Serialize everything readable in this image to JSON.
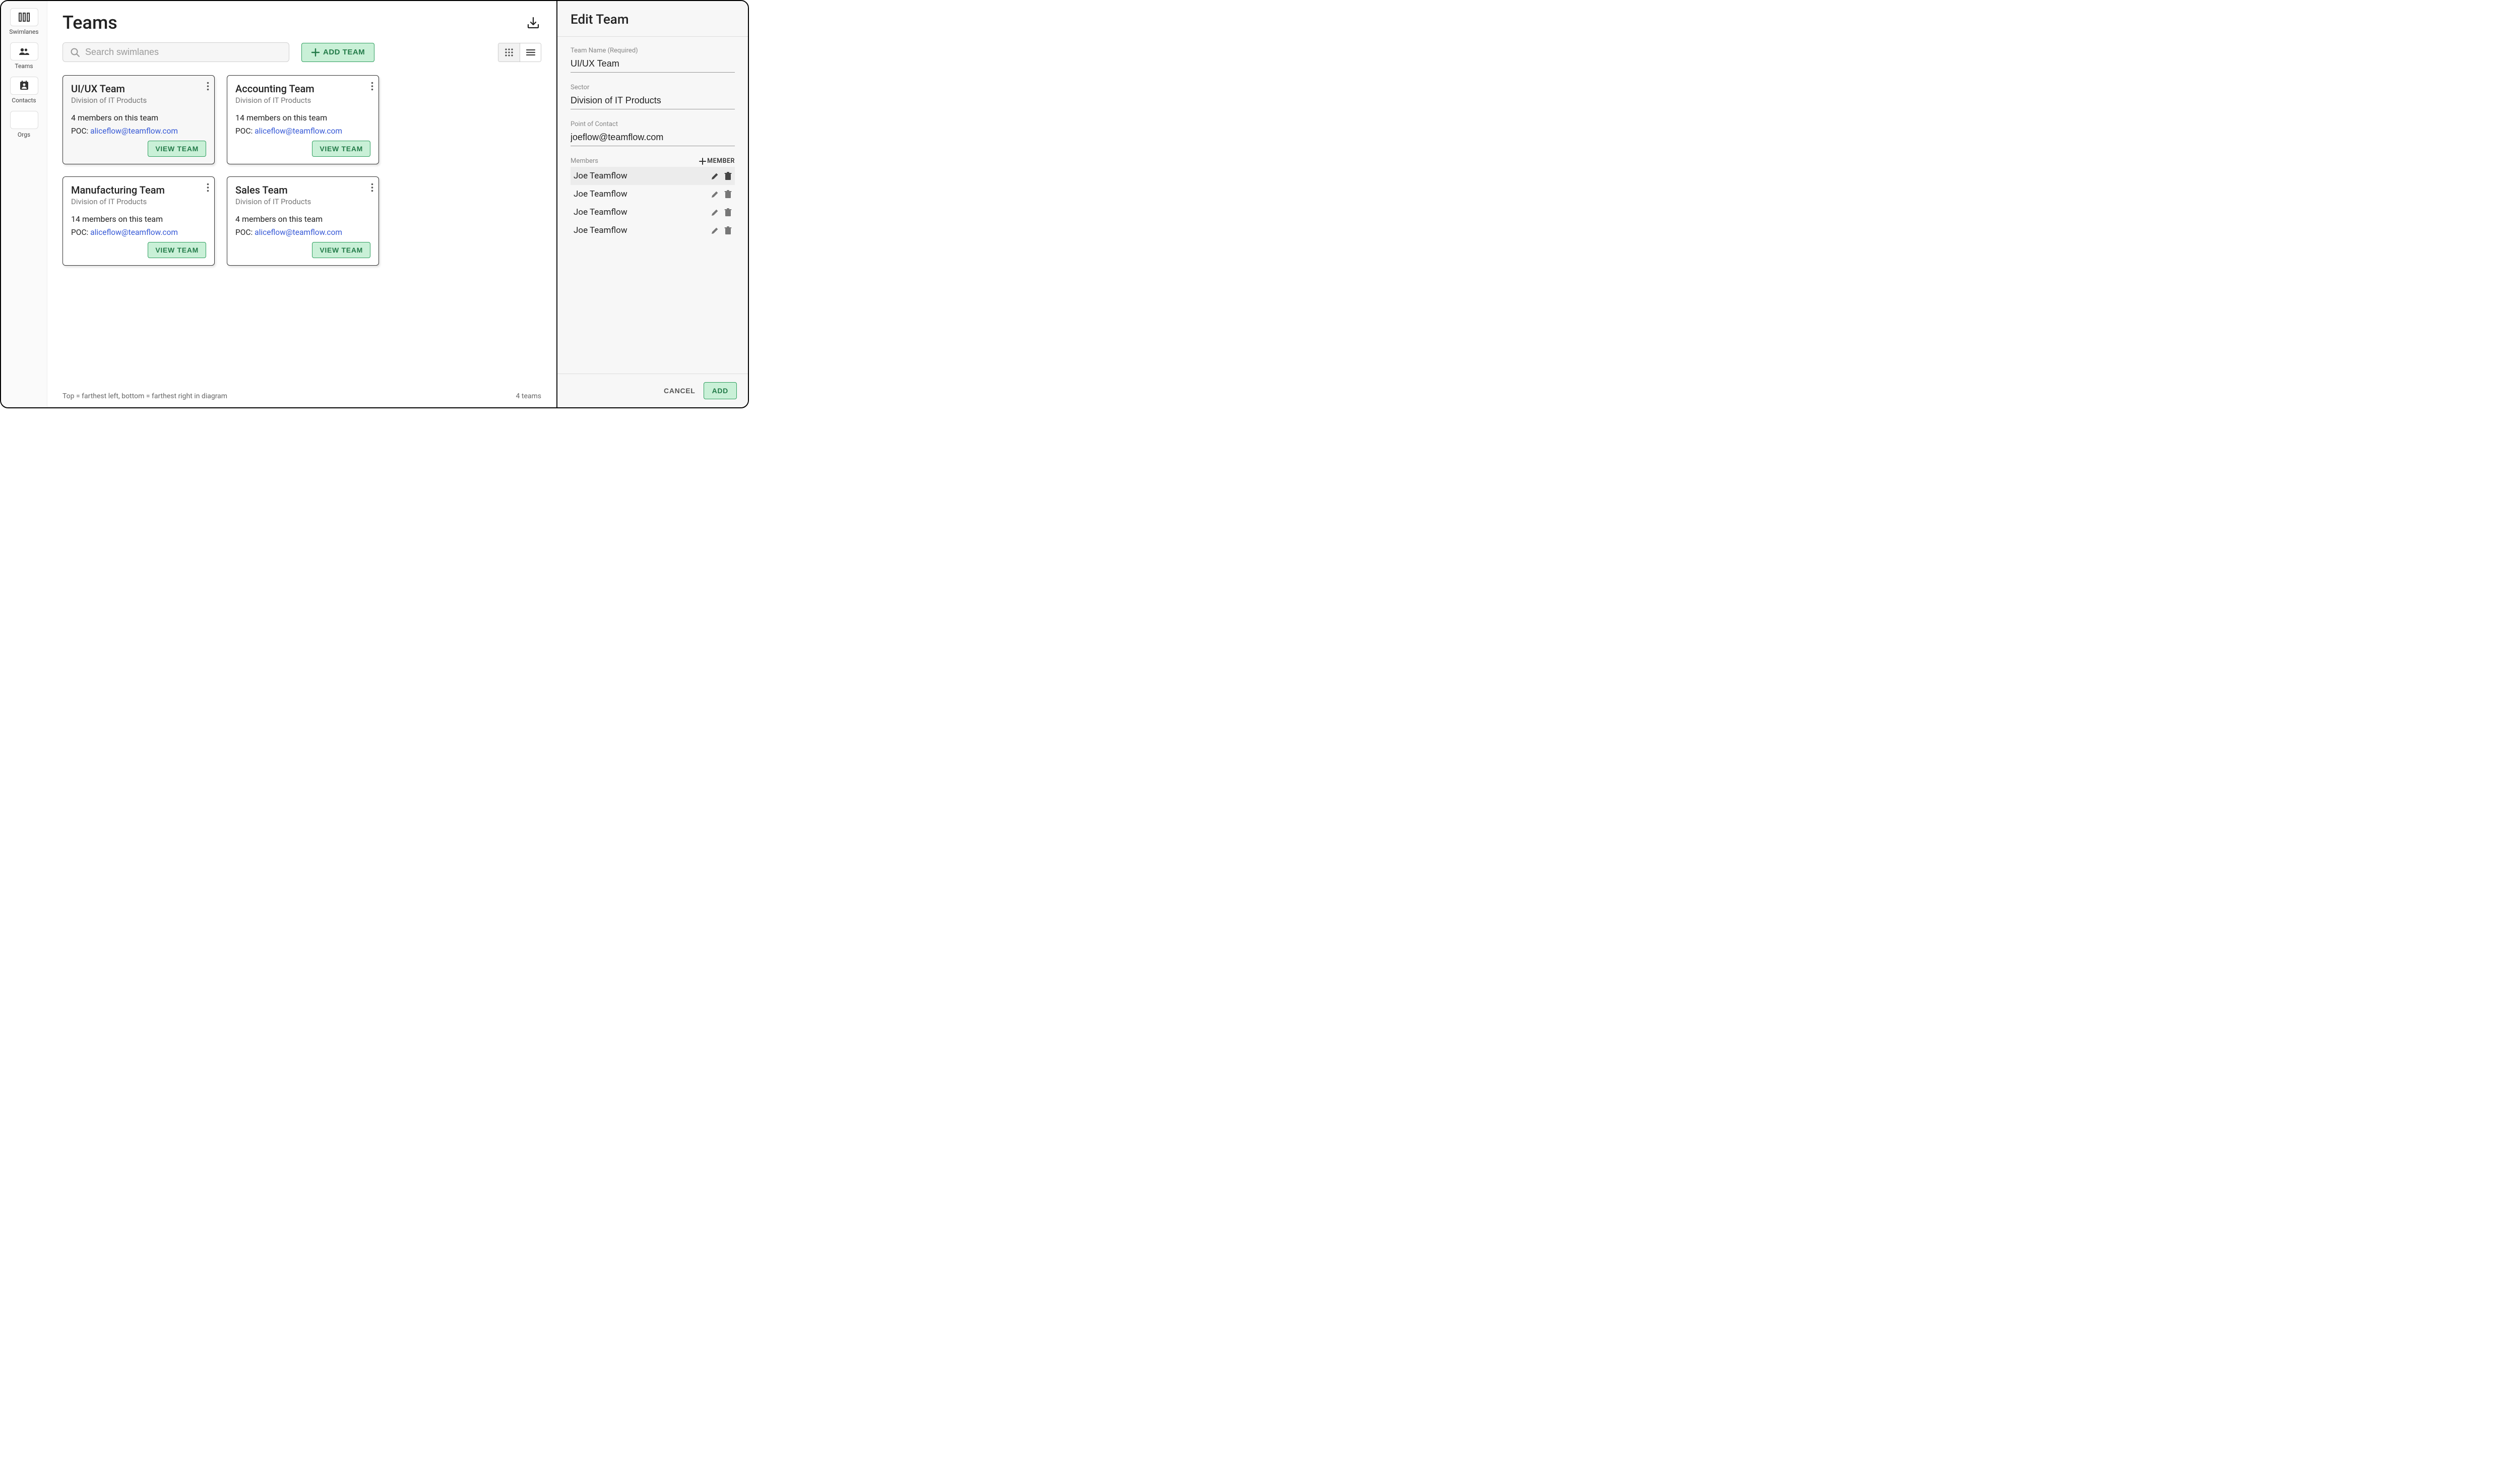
{
  "nav": {
    "items": [
      {
        "label": "Swimlanes",
        "icon": "swimlanes-icon"
      },
      {
        "label": "Teams",
        "icon": "teams-icon"
      },
      {
        "label": "Contacts",
        "icon": "contacts-icon"
      },
      {
        "label": "Orgs",
        "icon": "orgs-icon"
      }
    ]
  },
  "header": {
    "title": "Teams"
  },
  "toolbar": {
    "search_placeholder": "Search swimlanes",
    "add_team_label": "ADD TEAM"
  },
  "cards": [
    {
      "title": "UI/UX Team",
      "subtitle": "Division of IT Products",
      "members_text": "4 members on this team",
      "poc_label": "POC: ",
      "poc_email": "aliceflow@teamflow.com",
      "view_label": "VIEW TEAM",
      "selected": true
    },
    {
      "title": "Accounting Team",
      "subtitle": "Division of IT Products",
      "members_text": "14 members on this team",
      "poc_label": "POC: ",
      "poc_email": "aliceflow@teamflow.com",
      "view_label": "VIEW TEAM",
      "selected": false
    },
    {
      "title": "Manufacturing Team",
      "subtitle": "Division of IT Products",
      "members_text": "14 members on this team",
      "poc_label": "POC: ",
      "poc_email": "aliceflow@teamflow.com",
      "view_label": "VIEW TEAM",
      "selected": false
    },
    {
      "title": "Sales Team",
      "subtitle": "Division of IT Products",
      "members_text": "4 members on this team",
      "poc_label": "POC: ",
      "poc_email": "aliceflow@teamflow.com",
      "view_label": "VIEW TEAM",
      "selected": false
    }
  ],
  "footer": {
    "hint": "Top = farthest left, bottom = farthest right in diagram",
    "count_text": "4 teams"
  },
  "panel": {
    "title": "Edit Team",
    "fields": {
      "name_label": "Team Name (Required)",
      "name_value": "UI/UX Team",
      "sector_label": "Sector",
      "sector_value": "Division of IT Products",
      "poc_label": "Point of Contact",
      "poc_value": "joeflow@teamflow.com"
    },
    "members_label": "Members",
    "add_member_label": "MEMBER",
    "members": [
      {
        "name": "Joe Teamflow",
        "hover": true
      },
      {
        "name": "Joe Teamflow",
        "hover": false
      },
      {
        "name": "Joe Teamflow",
        "hover": false
      },
      {
        "name": "Joe Teamflow",
        "hover": false
      }
    ],
    "cancel_label": "CANCEL",
    "submit_label": "ADD"
  }
}
